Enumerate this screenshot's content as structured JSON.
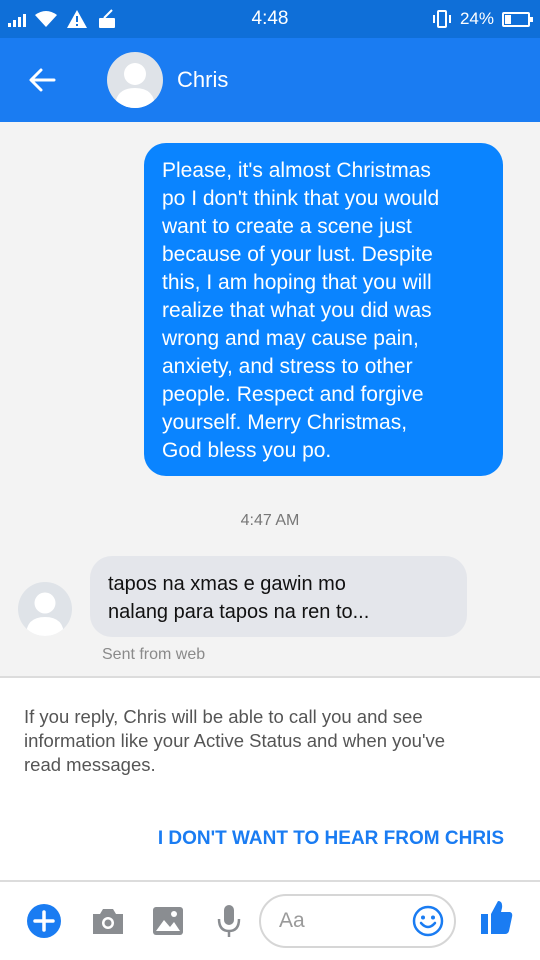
{
  "status_bar": {
    "time": "4:48",
    "battery_percent": "24%",
    "battery_level": 0.24,
    "icons": [
      "signal-icon",
      "wifi-icon",
      "warning-icon",
      "cleaner-icon",
      "vibrate-icon",
      "battery-icon"
    ]
  },
  "header": {
    "contact_name": "Chris",
    "icons": [
      "back-arrow-icon",
      "avatar"
    ]
  },
  "messages": [
    {
      "direction": "outgoing",
      "lines": [
        "Please, it's almost Christmas",
        "po I don't think that you would",
        "want to create a scene just",
        "because of your lust. Despite",
        "this, I am hoping that you will",
        "realize that what you did was",
        "wrong and may cause pain,",
        "anxiety, and stress to other",
        "people. Respect and forgive",
        "yourself. Merry Christmas,",
        "God bless you po."
      ]
    },
    {
      "direction": "incoming",
      "lines": [
        "tapos na xmas e gawin mo",
        "nalang para tapos na ren to..."
      ],
      "note": "Sent from web"
    }
  ],
  "timestamp": "4:47 AM",
  "notice": {
    "lines": [
      "If you reply, Chris will be able to call you and see",
      "information like your Active Status and when you've",
      "read messages."
    ],
    "action_label": "I DON'T WANT TO HEAR FROM CHRIS"
  },
  "composer": {
    "placeholder": "Aa",
    "icons": [
      "plus-icon",
      "camera-icon",
      "gallery-icon",
      "microphone-icon",
      "emoji-icon",
      "thumbs-up-icon"
    ],
    "accent": "#1a7cf2"
  },
  "colors": {
    "header": "#1a7cf2",
    "status_bar": "#0f6fd8",
    "outgoing_bubble": "#0a84ff",
    "incoming_bubble": "#e4e6eb"
  }
}
